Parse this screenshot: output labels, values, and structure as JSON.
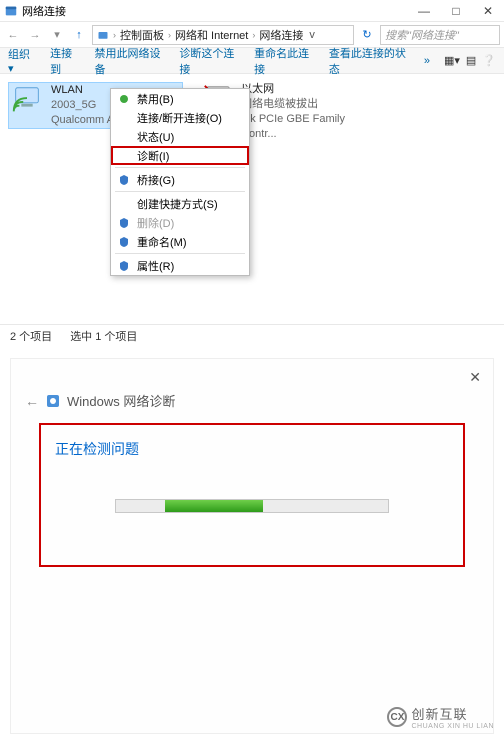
{
  "window": {
    "title": "网络连接",
    "min": "—",
    "max": "□",
    "close": "✕"
  },
  "nav": {
    "crumbs": [
      "控制面板",
      "网络和 Internet",
      "网络连接"
    ],
    "search_placeholder": "搜索\"网络连接\"",
    "dropdown": "v"
  },
  "toolbar": {
    "org": "组织 ▾",
    "connect": "连接到",
    "disable": "禁用此网络设备",
    "diagnose": "诊断这个连接",
    "rename": "重命名此连接",
    "status": "查看此连接的状态",
    "more": "»"
  },
  "connections": [
    {
      "name": "WLAN",
      "sub1": "2003_5G",
      "sub2": "Qualcomm Ath..."
    },
    {
      "name": "以太网",
      "sub1": "网络电缆被拔出",
      "sub2": "...k PCIe GBE Family Contr..."
    }
  ],
  "context_menu": {
    "disable": "禁用(B)",
    "connect": "连接/断开连接(O)",
    "status": "状态(U)",
    "diagnose": "诊断(I)",
    "bridge": "桥接(G)",
    "shortcut": "创建快捷方式(S)",
    "delete": "删除(D)",
    "rename": "重命名(M)",
    "properties": "属性(R)"
  },
  "statusbar": {
    "count": "2 个项目",
    "selected": "选中 1 个项目"
  },
  "diagnostic": {
    "header": "Windows 网络诊断",
    "message": "正在检测问题",
    "close": "✕",
    "back": "←"
  },
  "watermark": {
    "text1": "创新互联",
    "text2": "CHUANG XIN HU LIAN"
  }
}
